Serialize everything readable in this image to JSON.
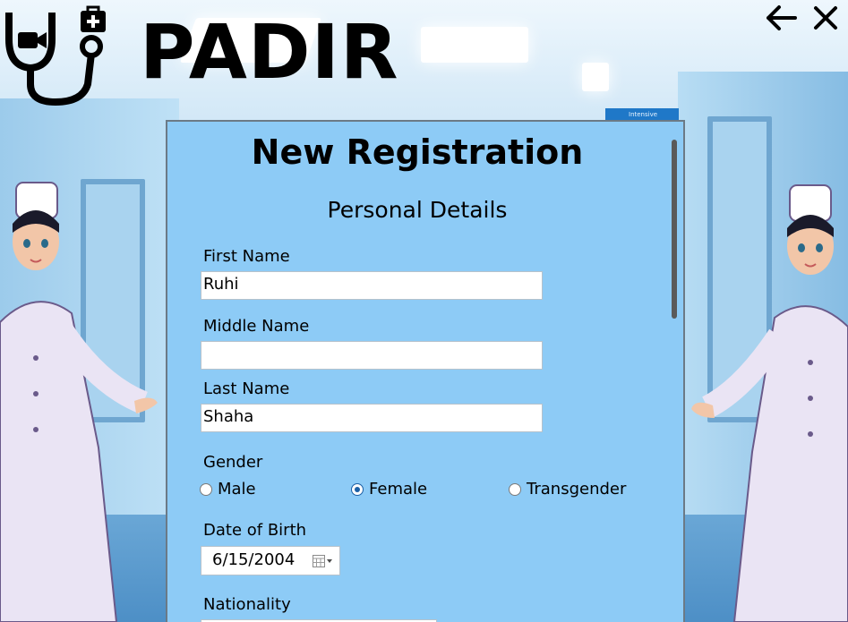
{
  "app": {
    "brand": "PADIR",
    "logo_icon": "stethoscope-medkit-icon",
    "back_icon": "arrow-left-icon",
    "close_icon": "close-icon"
  },
  "background": {
    "sign_text": "Intensive terapty"
  },
  "form": {
    "title": "New Registration",
    "section": "Personal Details",
    "first_name_label": "First Name",
    "first_name_value": "Ruhi",
    "middle_name_label": "Middle Name",
    "middle_name_value": "",
    "last_name_label": "Last Name",
    "last_name_value": "Shaha",
    "gender_label": "Gender",
    "gender_options": [
      "Male",
      "Female",
      "Transgender"
    ],
    "gender_selected": "Female",
    "dob_label": "Date of Birth",
    "dob_value": "6/15/2004",
    "nationality_label": "Nationality"
  },
  "colors": {
    "panel": "#8dcbf6",
    "radio_selected": "#1b5fa5"
  }
}
